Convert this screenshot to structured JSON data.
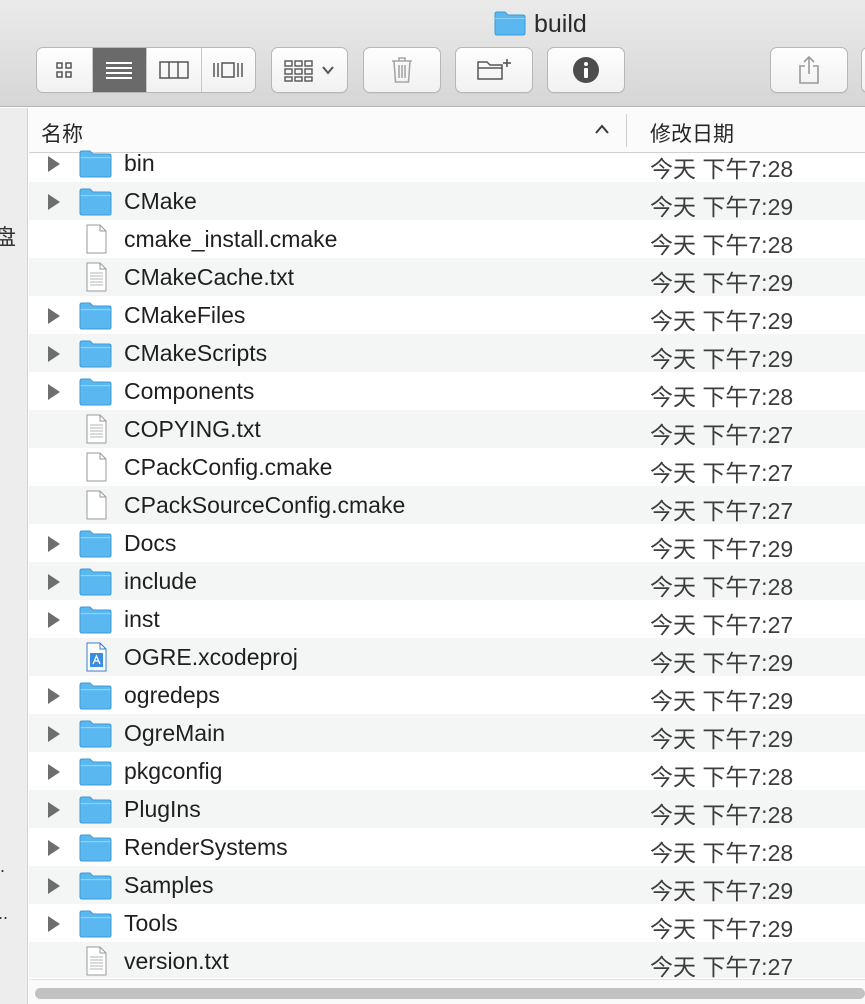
{
  "window": {
    "title": "build"
  },
  "toolbar": {
    "view_icons": "icon-view-icon",
    "view_list": "list-view-icon",
    "view_columns": "column-view-icon",
    "view_coverflow": "coverflow-view-icon",
    "arrange": "arrange-grid-icon",
    "trash": "trash-icon",
    "new_folder": "new-folder-icon",
    "info": "info-icon",
    "share": "share-icon"
  },
  "sidebar": {
    "partial_text_1": "盘",
    "partial_text_2": ".",
    "partial_text_3": ".."
  },
  "columns": {
    "name": "名称",
    "date": "修改日期"
  },
  "colors": {
    "folder": "#5bb7ef",
    "active_segment": "#6a6a6a",
    "row_alt": "#f4f5f5"
  },
  "files": [
    {
      "name": "bin",
      "date": "今天 下午7:28",
      "type": "folder"
    },
    {
      "name": "CMake",
      "date": "今天 下午7:29",
      "type": "folder"
    },
    {
      "name": "cmake_install.cmake",
      "date": "今天 下午7:28",
      "type": "file"
    },
    {
      "name": "CMakeCache.txt",
      "date": "今天 下午7:29",
      "type": "text"
    },
    {
      "name": "CMakeFiles",
      "date": "今天 下午7:29",
      "type": "folder"
    },
    {
      "name": "CMakeScripts",
      "date": "今天 下午7:29",
      "type": "folder"
    },
    {
      "name": "Components",
      "date": "今天 下午7:28",
      "type": "folder"
    },
    {
      "name": "COPYING.txt",
      "date": "今天 下午7:27",
      "type": "text"
    },
    {
      "name": "CPackConfig.cmake",
      "date": "今天 下午7:27",
      "type": "file"
    },
    {
      "name": "CPackSourceConfig.cmake",
      "date": "今天 下午7:27",
      "type": "file"
    },
    {
      "name": "Docs",
      "date": "今天 下午7:29",
      "type": "folder"
    },
    {
      "name": "include",
      "date": "今天 下午7:28",
      "type": "folder"
    },
    {
      "name": "inst",
      "date": "今天 下午7:27",
      "type": "folder"
    },
    {
      "name": "OGRE.xcodeproj",
      "date": "今天 下午7:29",
      "type": "xcode"
    },
    {
      "name": "ogredeps",
      "date": "今天 下午7:29",
      "type": "folder"
    },
    {
      "name": "OgreMain",
      "date": "今天 下午7:29",
      "type": "folder"
    },
    {
      "name": "pkgconfig",
      "date": "今天 下午7:28",
      "type": "folder"
    },
    {
      "name": "PlugIns",
      "date": "今天 下午7:28",
      "type": "folder"
    },
    {
      "name": "RenderSystems",
      "date": "今天 下午7:28",
      "type": "folder"
    },
    {
      "name": "Samples",
      "date": "今天 下午7:29",
      "type": "folder"
    },
    {
      "name": "Tools",
      "date": "今天 下午7:29",
      "type": "folder"
    },
    {
      "name": "version.txt",
      "date": "今天 下午7:27",
      "type": "text"
    }
  ]
}
